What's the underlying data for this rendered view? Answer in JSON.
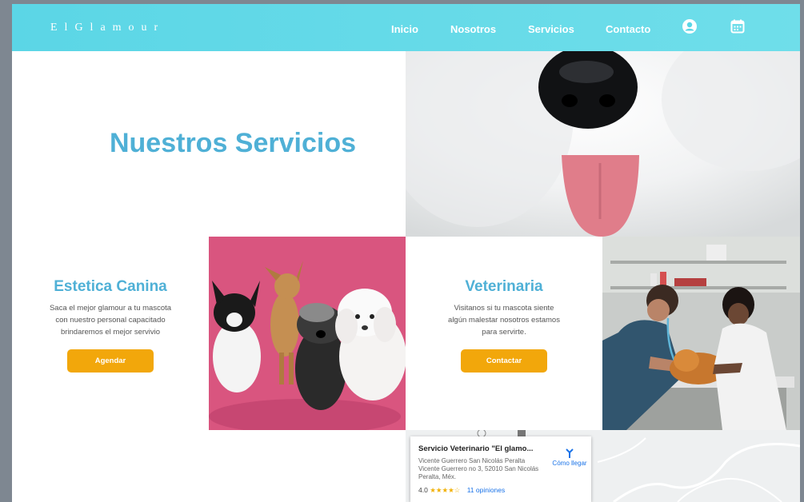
{
  "brand": "ElGlamour",
  "nav": {
    "items": [
      {
        "label": "Inicio"
      },
      {
        "label": "Nosotros"
      },
      {
        "label": "Servicios"
      },
      {
        "label": "Contacto"
      }
    ],
    "icons": [
      "user-icon",
      "calendar-icon"
    ]
  },
  "hero": {
    "title": "Nuestros Servicios",
    "image_icon": "dog-nose-photo"
  },
  "services": [
    {
      "title": "Estetica Canina",
      "description": "Saca el mejor glamour a tu mascota con nuestro personal capacitado brindaremos el mejor servivio",
      "button": "Agendar",
      "image_icon": "small-dogs-photo"
    },
    {
      "title": "Veterinaria",
      "description": "Visitanos si tu mascota siente algún malestar nosotros estamos para servirte.",
      "button": "Contactar",
      "image_icon": "vet-exam-photo"
    }
  ],
  "map": {
    "name": "Servicio Veterinario \"El glamo...",
    "address": "Vicente Guerrero San Nicolás Peralta Vicente Guerrero no 3, 52010 San Nicolás Peralta, Méx.",
    "rating": "4.0",
    "stars": "★★★★☆",
    "reviews": "11 opiniones",
    "directions": "Cómo llegar"
  },
  "colors": {
    "navbar": "#5bd6e6",
    "title": "#4fb0d6",
    "button": "#f2a70b"
  }
}
